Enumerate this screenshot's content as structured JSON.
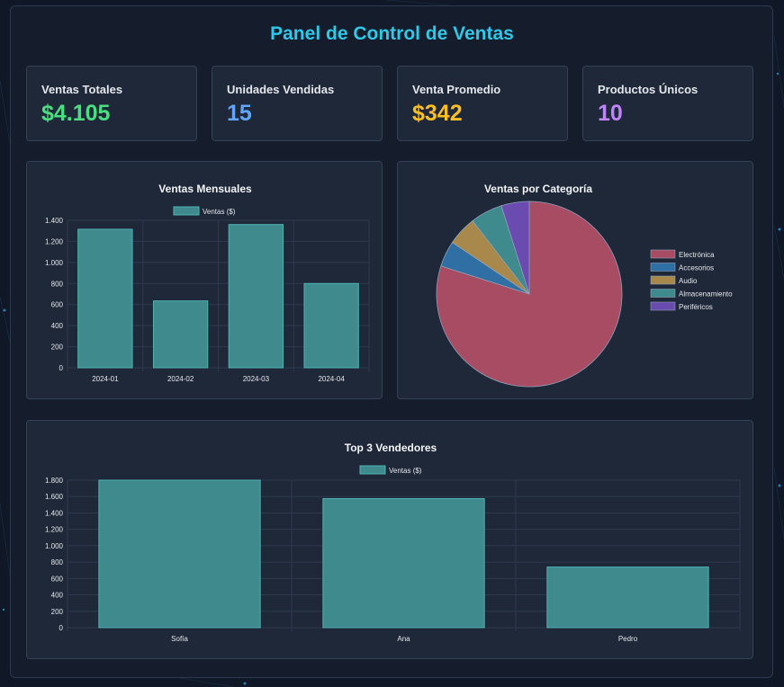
{
  "header": {
    "title": "Panel de Control de Ventas"
  },
  "stats": [
    {
      "label": "Ventas Totales",
      "value": "$4.105",
      "color": "#4ade80"
    },
    {
      "label": "Unidades Vendidas",
      "value": "15",
      "color": "#60a5fa"
    },
    {
      "label": "Venta Promedio",
      "value": "$342",
      "color": "#fbbf24"
    },
    {
      "label": "Productos Únicos",
      "value": "10",
      "color": "#c084fc"
    }
  ],
  "colors": {
    "teal": "#3e8a8c",
    "teal_border": "#4fb3b3",
    "grid": "#2d3a4d"
  },
  "chart_data": [
    {
      "type": "bar",
      "title": "Ventas Mensuales",
      "legend": "Ventas ($)",
      "categories": [
        "2024-01",
        "2024-02",
        "2024-03",
        "2024-04"
      ],
      "values": [
        1315,
        635,
        1360,
        800
      ],
      "yticks": [
        "0",
        "200",
        "400",
        "600",
        "800",
        "1.000",
        "1.200",
        "1.400"
      ],
      "ylim": [
        0,
        1400
      ],
      "grid": true,
      "legend_placement": "top"
    },
    {
      "type": "pie",
      "title": "Ventas por Categoría",
      "categories": [
        "Electrónica",
        "Accesorios",
        "Audio",
        "Almacenamiento",
        "Periféricos"
      ],
      "values": [
        3280,
        185,
        210,
        230,
        200
      ],
      "colors": [
        "#a84c63",
        "#2f6fa3",
        "#a8894b",
        "#3e8a8c",
        "#6a4bb0"
      ],
      "legend_placement": "right"
    },
    {
      "type": "bar",
      "title": "Top 3 Vendedores",
      "legend": "Ventas ($)",
      "categories": [
        "Sofía",
        "Ana",
        "Pedro"
      ],
      "values": [
        1800,
        1575,
        740
      ],
      "yticks": [
        "0",
        "200",
        "400",
        "600",
        "800",
        "1.000",
        "1.200",
        "1.400",
        "1.600",
        "1.800"
      ],
      "ylim": [
        0,
        1800
      ],
      "grid": true,
      "legend_placement": "top"
    }
  ]
}
